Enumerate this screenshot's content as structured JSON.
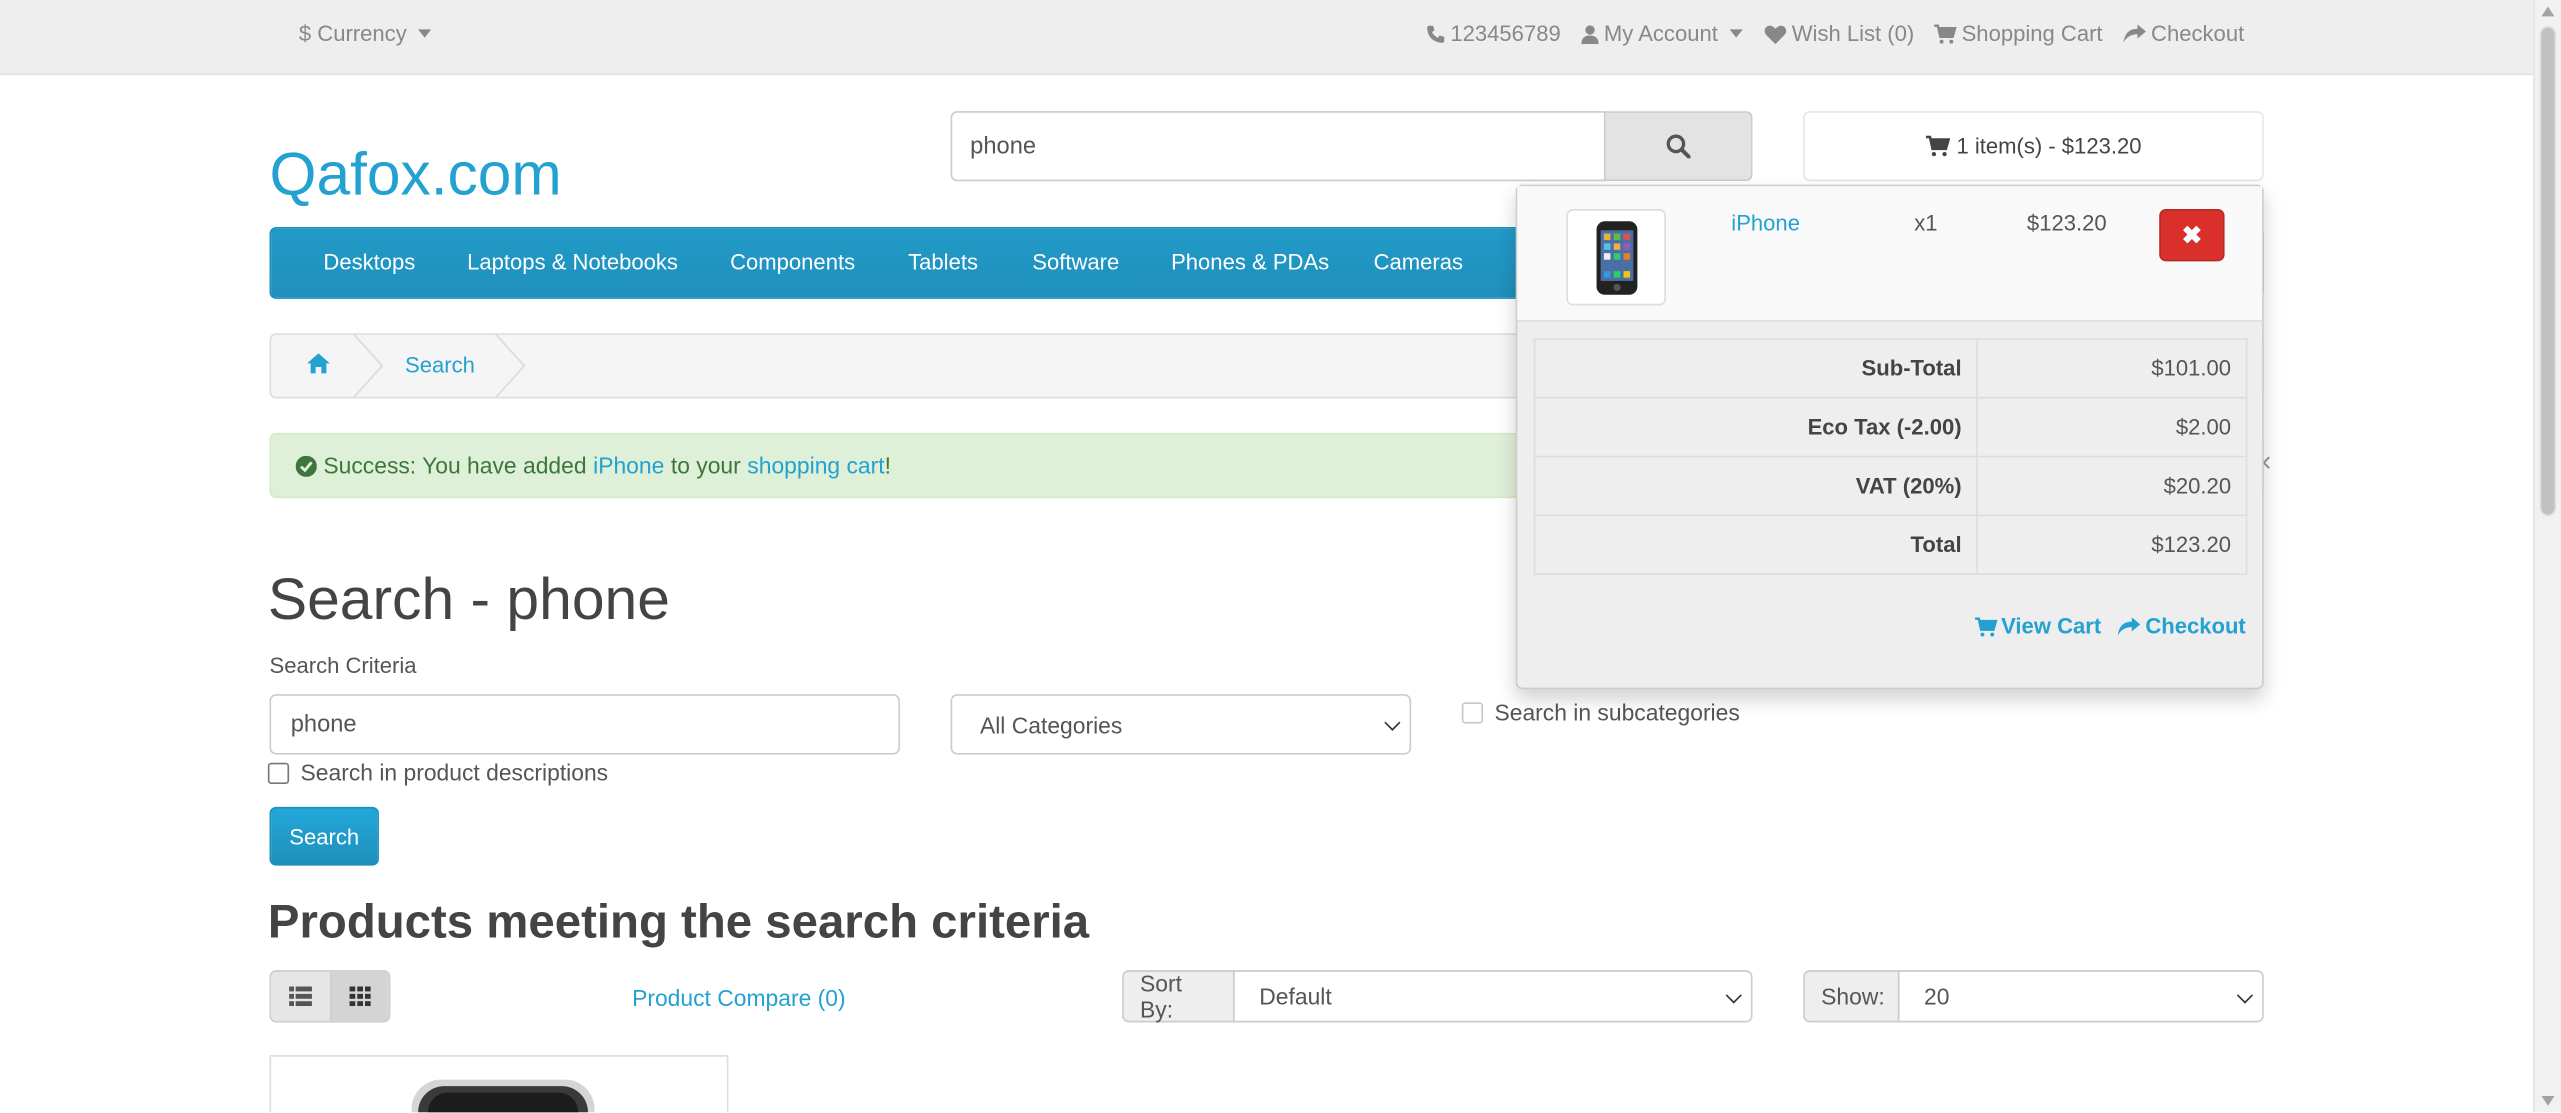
{
  "topbar": {
    "currency_label": "$ Currency",
    "phone": "123456789",
    "my_account": "My Account",
    "wishlist": "Wish List (0)",
    "shopping_cart": "Shopping Cart",
    "checkout": "Checkout"
  },
  "header": {
    "logo": "Qafox.com",
    "search_value": "phone",
    "cart_button": "1 item(s) - $123.20"
  },
  "menu": {
    "items": [
      "Desktops",
      "Laptops & Notebooks",
      "Components",
      "Tablets",
      "Software",
      "Phones & PDAs",
      "Cameras"
    ]
  },
  "breadcrumb": {
    "current": "Search"
  },
  "alert": {
    "prefix": "Success: You have added",
    "product_link": "iPhone",
    "middle": "to your",
    "cart_link": "shopping cart",
    "suffix": "!",
    "close": "×"
  },
  "page": {
    "title": "Search - phone",
    "criteria_label": "Search Criteria",
    "criteria_value": "phone",
    "category_select": "All Categories",
    "subcategories_label": "Search in subcategories",
    "descriptions_label": "Search in product descriptions",
    "search_button": "Search",
    "products_title": "Products meeting the search criteria",
    "product_compare": "Product Compare (0)",
    "sort_by_label": "Sort By:",
    "sort_by_value": "Default",
    "show_label": "Show:",
    "show_value": "20"
  },
  "cart_dropdown": {
    "product_name": "iPhone",
    "quantity": "x1",
    "price": "$123.20",
    "remove_symbol": "✖",
    "totals": [
      {
        "label": "Sub-Total",
        "value": "$101.00"
      },
      {
        "label": "Eco Tax (-2.00)",
        "value": "$2.00"
      },
      {
        "label": "VAT (20%)",
        "value": "$20.20"
      },
      {
        "label": "Total",
        "value": "$123.20"
      }
    ],
    "view_cart": "View Cart",
    "checkout": "Checkout"
  },
  "colors": {
    "accent": "#23a1d1",
    "menu_bg": "#229ac8",
    "success_bg": "#dff0d8",
    "danger": "#d9302c"
  }
}
